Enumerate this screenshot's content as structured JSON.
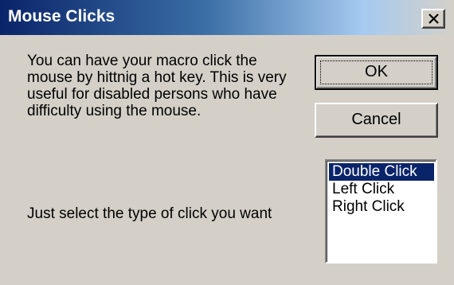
{
  "window": {
    "title": "Mouse Clicks",
    "close_icon": "close-icon"
  },
  "description": "You can have your macro click the mouse by hittnig a hot key.  This is very useful for disabled persons who have difficulty using the mouse.",
  "select_prompt": "Just select the type of click you want",
  "buttons": {
    "ok_label": "OK",
    "cancel_label": "Cancel"
  },
  "click_types": {
    "items": [
      "Double Click",
      "Left Click",
      "Right Click"
    ],
    "selected": "Double Click"
  },
  "colors": {
    "title_bar_start": "#0a246a",
    "title_bar_end": "#a6caf0",
    "dialog_background": "#d4d0c8",
    "selection_background": "#0a246a"
  }
}
